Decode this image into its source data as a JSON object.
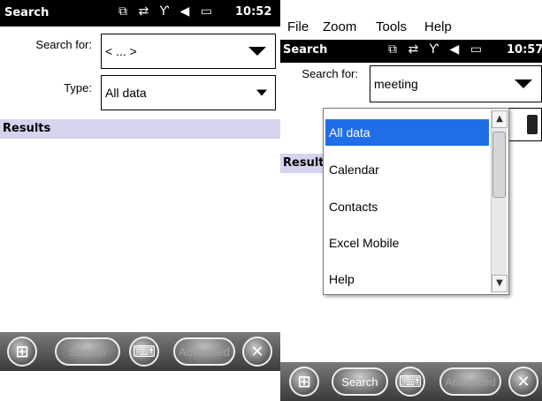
{
  "left": {
    "status": {
      "title": "Search",
      "icons": "⧉ ⇄ Ƴ ◀ ▭",
      "time": "10:52"
    },
    "search_for": {
      "label": "Search for:",
      "value": "< ... >"
    },
    "type": {
      "label": "Type:",
      "value": "All data"
    },
    "results_label": "Results",
    "softkeys": {
      "search": "Search",
      "advanced": "Advanced"
    }
  },
  "right": {
    "menu": [
      "File",
      "Zoom",
      "Tools",
      "Help"
    ],
    "status": {
      "title": "Search",
      "icons": "⧉ ⇄ Ƴ ◀ ▭",
      "time": "10:57"
    },
    "search_for": {
      "label": "Search for:",
      "value": "meeting"
    },
    "results_label": "Result",
    "dropdown": {
      "items": [
        "All data",
        "Calendar",
        "Contacts",
        "Excel Mobile",
        "Help"
      ],
      "selected": "All data"
    },
    "softkeys": {
      "search": "Search",
      "advanced": "Advanced"
    }
  },
  "icons": {
    "windows": "windows-icon",
    "keyboard": "keyboard-icon",
    "close": "close-icon"
  },
  "colors": {
    "results_bar": "#d4d4ef",
    "selected_item": "#1f6ee8",
    "status_bar": "#000000"
  }
}
